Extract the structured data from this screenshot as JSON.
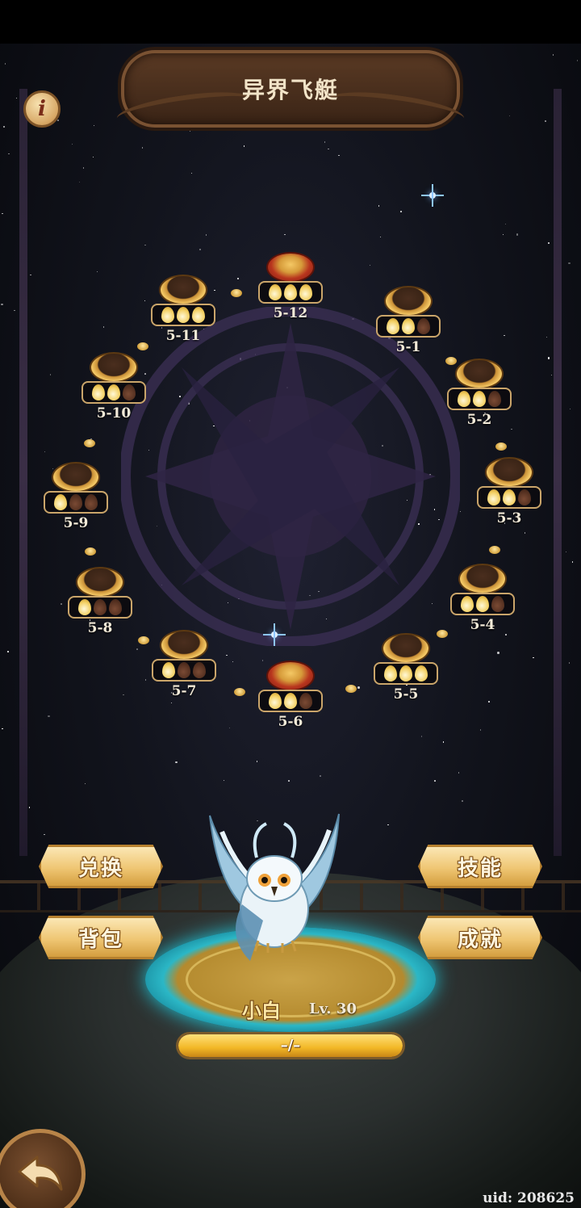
{
  "header": {
    "title": "异界飞艇"
  },
  "info_button": {
    "icon": "info-icon",
    "glyph": "i"
  },
  "stages": [
    {
      "label": "5-1",
      "stars": 2,
      "boss": false
    },
    {
      "label": "5-2",
      "stars": 2,
      "boss": false
    },
    {
      "label": "5-3",
      "stars": 2,
      "boss": false
    },
    {
      "label": "5-4",
      "stars": 2,
      "boss": false
    },
    {
      "label": "5-5",
      "stars": 3,
      "boss": false
    },
    {
      "label": "5-6",
      "stars": 2,
      "boss": true
    },
    {
      "label": "5-7",
      "stars": 1,
      "boss": false
    },
    {
      "label": "5-8",
      "stars": 1,
      "boss": false
    },
    {
      "label": "5-9",
      "stars": 1,
      "boss": false
    },
    {
      "label": "5-10",
      "stars": 2,
      "boss": false
    },
    {
      "label": "5-11",
      "stars": 3,
      "boss": false
    },
    {
      "label": "5-12",
      "stars": 3,
      "boss": true
    }
  ],
  "actions": {
    "exchange": "兑换",
    "skills": "技能",
    "bag": "背包",
    "achievements": "成就"
  },
  "pet": {
    "name": "小白",
    "level": "Lv. 30",
    "exp_text": "–/–",
    "exp_fraction": 1.0
  },
  "back_button": {
    "icon": "back-arrow-icon"
  },
  "footer": {
    "uid": "uid: 208625"
  },
  "colors": {
    "gold": "#efc673",
    "star_on": "#f3d064",
    "star_off": "#4e2c1d",
    "boss_red": "#b8351e",
    "cyan_glow": "#2bb7c6"
  }
}
